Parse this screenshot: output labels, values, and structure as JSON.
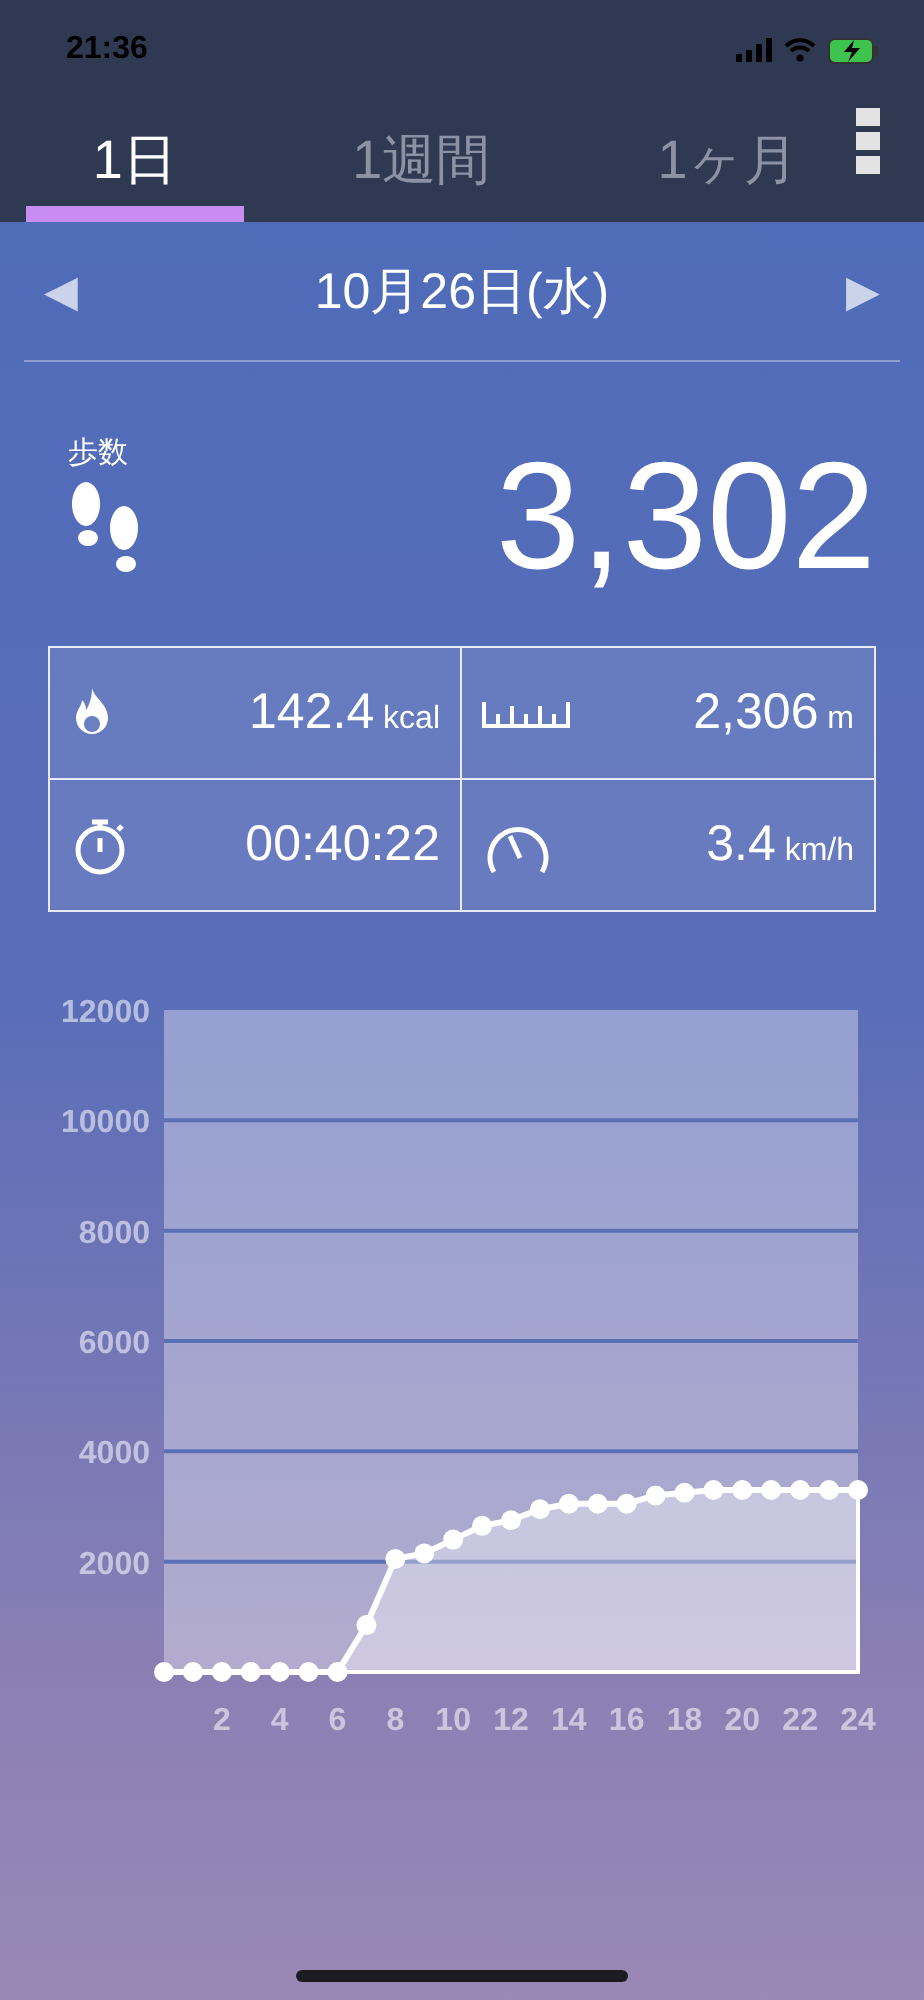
{
  "status_bar": {
    "time": "21:36"
  },
  "tabs": [
    {
      "label": "1日",
      "selected": true
    },
    {
      "label": "1週間",
      "selected": false
    },
    {
      "label": "1ヶ月",
      "selected": false
    }
  ],
  "date_nav": {
    "prev": "◀",
    "date": "10月26日(水)",
    "next": "▶"
  },
  "steps": {
    "label": "歩数",
    "value": "3,302"
  },
  "stats": [
    {
      "kind": "calories",
      "value": "142.4",
      "unit": "kcal"
    },
    {
      "kind": "distance",
      "value": "2,306",
      "unit": "m"
    },
    {
      "kind": "time",
      "value": "00:40:22"
    },
    {
      "kind": "speed",
      "value": "3.4",
      "unit": "km/h"
    }
  ],
  "chart": {
    "chart_data": {
      "type": "area",
      "x": [
        0,
        1,
        2,
        3,
        4,
        5,
        6,
        7,
        8,
        9,
        10,
        11,
        12,
        13,
        14,
        15,
        16,
        17,
        18,
        19,
        20,
        21,
        22,
        23,
        24
      ],
      "series": [
        {
          "color": "#ffffff",
          "values": [
            0,
            0,
            0,
            0,
            0,
            0,
            0,
            850,
            2050,
            2150,
            2400,
            2650,
            2750,
            2950,
            3050,
            3050,
            3050,
            3200,
            3250,
            3300,
            3300,
            3300,
            3300,
            3300,
            3300
          ]
        }
      ],
      "grid": true,
      "xlim": [
        0,
        24
      ],
      "ylim": [
        0,
        12000
      ],
      "xticks": [
        2,
        4,
        6,
        8,
        10,
        12,
        14,
        16,
        18,
        20,
        22,
        24
      ],
      "yticks": [
        2000,
        4000,
        6000,
        8000,
        10000,
        12000
      ]
    }
  }
}
